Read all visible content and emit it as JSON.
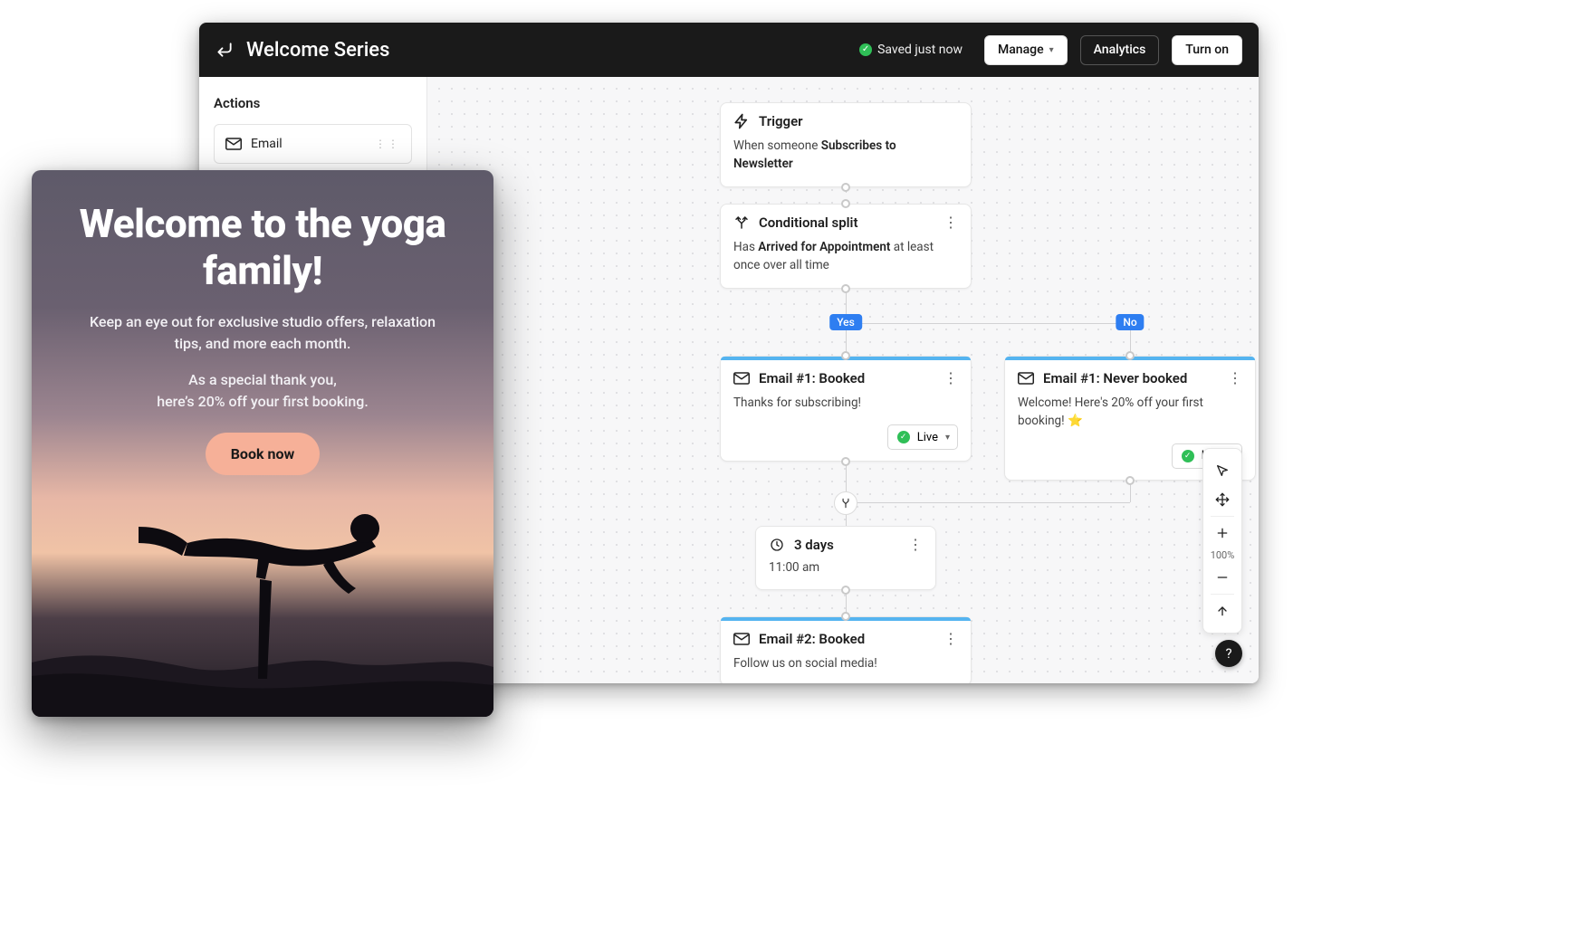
{
  "header": {
    "title": "Welcome Series",
    "save_status": "Saved just now",
    "manage_label": "Manage",
    "analytics_label": "Analytics",
    "turn_on_label": "Turn on"
  },
  "sidebar": {
    "heading": "Actions",
    "items": [
      {
        "label": "Email"
      }
    ]
  },
  "flow": {
    "trigger": {
      "title": "Trigger",
      "desc_prefix": "When someone ",
      "desc_bold": "Subscribes to Newsletter"
    },
    "split": {
      "title": "Conditional split",
      "desc_prefix": "Has ",
      "desc_bold": "Arrived for Appointment",
      "desc_suffix": " at least once over all time"
    },
    "branch_yes": "Yes",
    "branch_no": "No",
    "email_yes": {
      "title": "Email #1: Booked",
      "body": "Thanks for subscribing!",
      "status": "Live"
    },
    "email_no": {
      "title": "Email #1: Never booked",
      "body": "Welcome! Here's 20% off your first booking! ⭐",
      "status": "Live"
    },
    "delay": {
      "title": "3 days",
      "subtitle": "11:00 am"
    },
    "email2": {
      "title": "Email #2: Booked",
      "body": "Follow us on social media!"
    }
  },
  "toolbar": {
    "zoom": "100%"
  },
  "preview": {
    "headline": "Welcome to the yoga family!",
    "p1": "Keep an eye out for exclusive studio offers, relaxation tips, and more each month.",
    "p2a": "As a special thank you,",
    "p2b": "here’s 20% off your first booking.",
    "cta": "Book now"
  },
  "help": "?"
}
